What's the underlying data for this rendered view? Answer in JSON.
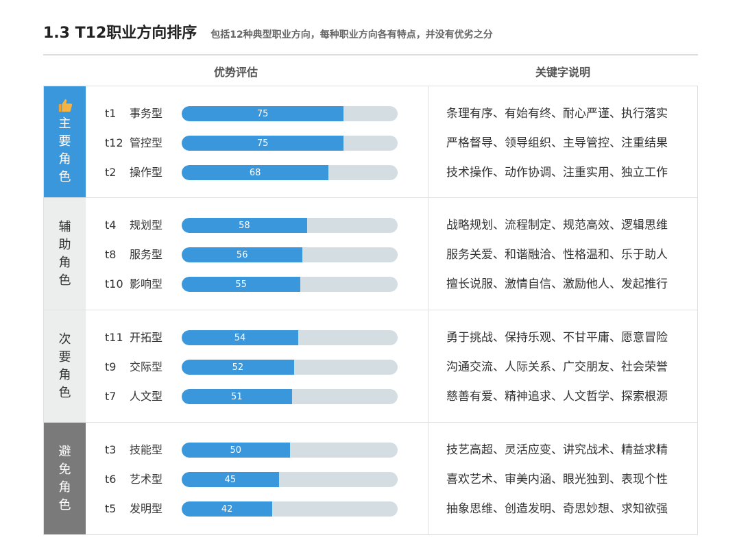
{
  "title": "1.3 T12职业方向排序",
  "subtitle": "包括12种典型职业方向，每种职业方向各有特点，并没有优劣之分",
  "columns": {
    "evaluation": "优势评估",
    "keywords": "关键字说明"
  },
  "colors": {
    "primary": "#3a97dc",
    "track": "#d4dde1",
    "secondary_bg": "#eceeee",
    "avoid_bg": "#7a7a7a"
  },
  "groups": [
    {
      "role": "主要角色",
      "style": "primary",
      "icon": "thumbs-up-icon",
      "items": [
        {
          "code": "t1",
          "type": "事务型",
          "score": 75,
          "keywords": "条理有序、有始有终、耐心严谨、执行落实"
        },
        {
          "code": "t12",
          "type": "管控型",
          "score": 75,
          "keywords": "严格督导、领导组织、主导管控、注重结果"
        },
        {
          "code": "t2",
          "type": "操作型",
          "score": 68,
          "keywords": "技术操作、动作协调、注重实用、独立工作"
        }
      ]
    },
    {
      "role": "辅助角色",
      "style": "secondary",
      "items": [
        {
          "code": "t4",
          "type": "规划型",
          "score": 58,
          "keywords": "战略规划、流程制定、规范高效、逻辑思维"
        },
        {
          "code": "t8",
          "type": "服务型",
          "score": 56,
          "keywords": "服务关爱、和谐融洽、性格温和、乐于助人"
        },
        {
          "code": "t10",
          "type": "影响型",
          "score": 55,
          "keywords": "擅长说服、激情自信、激励他人、发起推行"
        }
      ]
    },
    {
      "role": "次要角色",
      "style": "secondary",
      "items": [
        {
          "code": "t11",
          "type": "开拓型",
          "score": 54,
          "keywords": "勇于挑战、保持乐观、不甘平庸、愿意冒险"
        },
        {
          "code": "t9",
          "type": "交际型",
          "score": 52,
          "keywords": "沟通交流、人际关系、广交朋友、社会荣誉"
        },
        {
          "code": "t7",
          "type": "人文型",
          "score": 51,
          "keywords": "慈善有爱、精神追求、人文哲学、探索根源"
        }
      ]
    },
    {
      "role": "避免角色",
      "style": "avoid",
      "items": [
        {
          "code": "t3",
          "type": "技能型",
          "score": 50,
          "keywords": "技艺高超、灵活应变、讲究战术、精益求精"
        },
        {
          "code": "t6",
          "type": "艺术型",
          "score": 45,
          "keywords": "喜欢艺术、审美内涵、眼光独到、表现个性"
        },
        {
          "code": "t5",
          "type": "发明型",
          "score": 42,
          "keywords": "抽象思维、创造发明、奇思妙想、求知欲强"
        }
      ]
    }
  ]
}
